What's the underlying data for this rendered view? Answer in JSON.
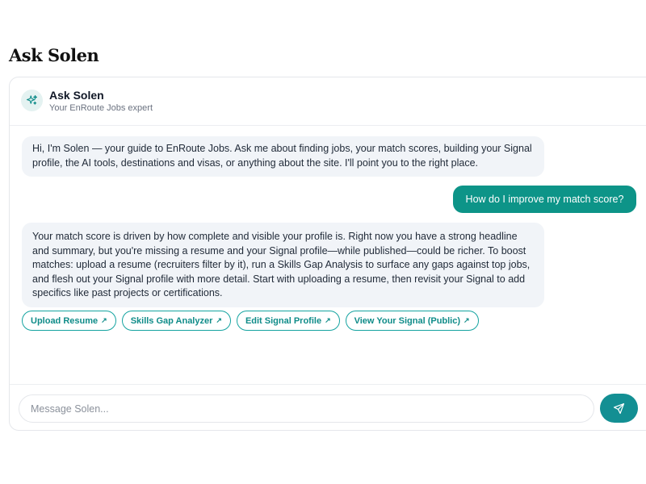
{
  "page": {
    "title": "Ask Solen"
  },
  "header": {
    "name": "Ask Solen",
    "subtitle": "Your EnRoute Jobs expert",
    "avatar_icon": "sparkle-icon"
  },
  "messages": [
    {
      "role": "assistant",
      "text": "Hi, I'm Solen — your guide to EnRoute Jobs. Ask me about finding jobs, your match scores, building your Signal profile, the AI tools, destinations and visas, or anything about the site. I'll point you to the right place."
    },
    {
      "role": "user",
      "text": "How do I improve my match score?"
    },
    {
      "role": "assistant",
      "text": "Your match score is driven by how complete and visible your profile is. Right now you have a strong headline and summary, but you're missing a resume and your Signal profile—while published—could be richer. To boost matches: upload a resume (recruiters filter by it), run a Skills Gap Analysis to surface any gaps against top jobs, and flesh out your Signal profile with more detail. Start with uploading a resume, then revisit your Signal to add specifics like past projects or certifications."
    }
  ],
  "actions": [
    {
      "label": "Upload Resume",
      "icon": "external-arrow-icon"
    },
    {
      "label": "Skills Gap Analyzer",
      "icon": "external-arrow-icon"
    },
    {
      "label": "Edit Signal Profile",
      "icon": "external-arrow-icon"
    },
    {
      "label": "View Your Signal (Public)",
      "icon": "external-arrow-icon"
    }
  ],
  "composer": {
    "value": "",
    "placeholder": "Message Solen...",
    "send_icon": "send-icon"
  },
  "colors": {
    "accent": "#0d9488",
    "bubble_bg": "#f1f4f8",
    "chip_border": "#14a3a0"
  }
}
